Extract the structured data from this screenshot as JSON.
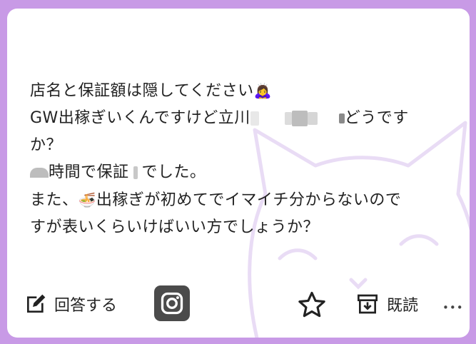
{
  "message": {
    "line1": "店名と保証額は隠してください",
    "line2_start": "GW出稼ぎいくんですけど立川",
    "line2_end": "どうです",
    "line3": "か？",
    "line4_mid": "時間で保証",
    "line4_end": "でした。",
    "line5_start": "また、",
    "line5_end": "出稼ぎが初めてでイマイチ分からないので",
    "line6": "すが表いくらいけばいい方でしょうか？"
  },
  "actions": {
    "answer_label": "回答する",
    "archive_label": "既読",
    "more_label": "•••"
  },
  "icons": [
    "edit-icon",
    "instagram-icon",
    "star-icon",
    "archive-icon",
    "more-icon",
    "girl-emoji-icon",
    "ramen-emoji-icon"
  ],
  "colors": {
    "border": "#c89ae6",
    "watermark": "#e9dcf5",
    "text": "#222222"
  }
}
